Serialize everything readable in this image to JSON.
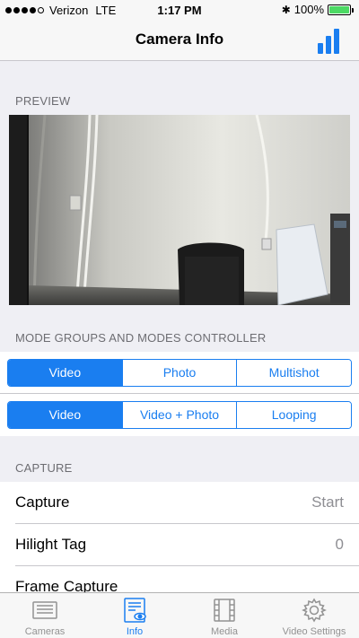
{
  "status_bar": {
    "carrier": "Verizon",
    "network": "LTE",
    "time": "1:17 PM",
    "battery": "100%",
    "battery_level": 1.0
  },
  "nav": {
    "title": "Camera Info"
  },
  "sections": {
    "preview": "PREVIEW",
    "mode_groups": "MODE GROUPS AND MODES CONTROLLER",
    "capture": "CAPTURE"
  },
  "mode_groups": [
    "Video",
    "Photo",
    "Multishot"
  ],
  "modes": [
    "Video",
    "Video + Photo",
    "Looping"
  ],
  "capture_rows": [
    {
      "label": "Capture",
      "value": "Start"
    },
    {
      "label": "Hilight Tag",
      "value": "0"
    },
    {
      "label": "Frame Capture",
      "value": ""
    }
  ],
  "tabs": [
    {
      "label": "Cameras",
      "icon": "list-icon"
    },
    {
      "label": "Info",
      "icon": "info-icon"
    },
    {
      "label": "Media",
      "icon": "film-icon"
    },
    {
      "label": "Video Settings",
      "icon": "gear-icon"
    }
  ],
  "colors": {
    "accent": "#1a7ef0",
    "battery": "#4cd964"
  }
}
